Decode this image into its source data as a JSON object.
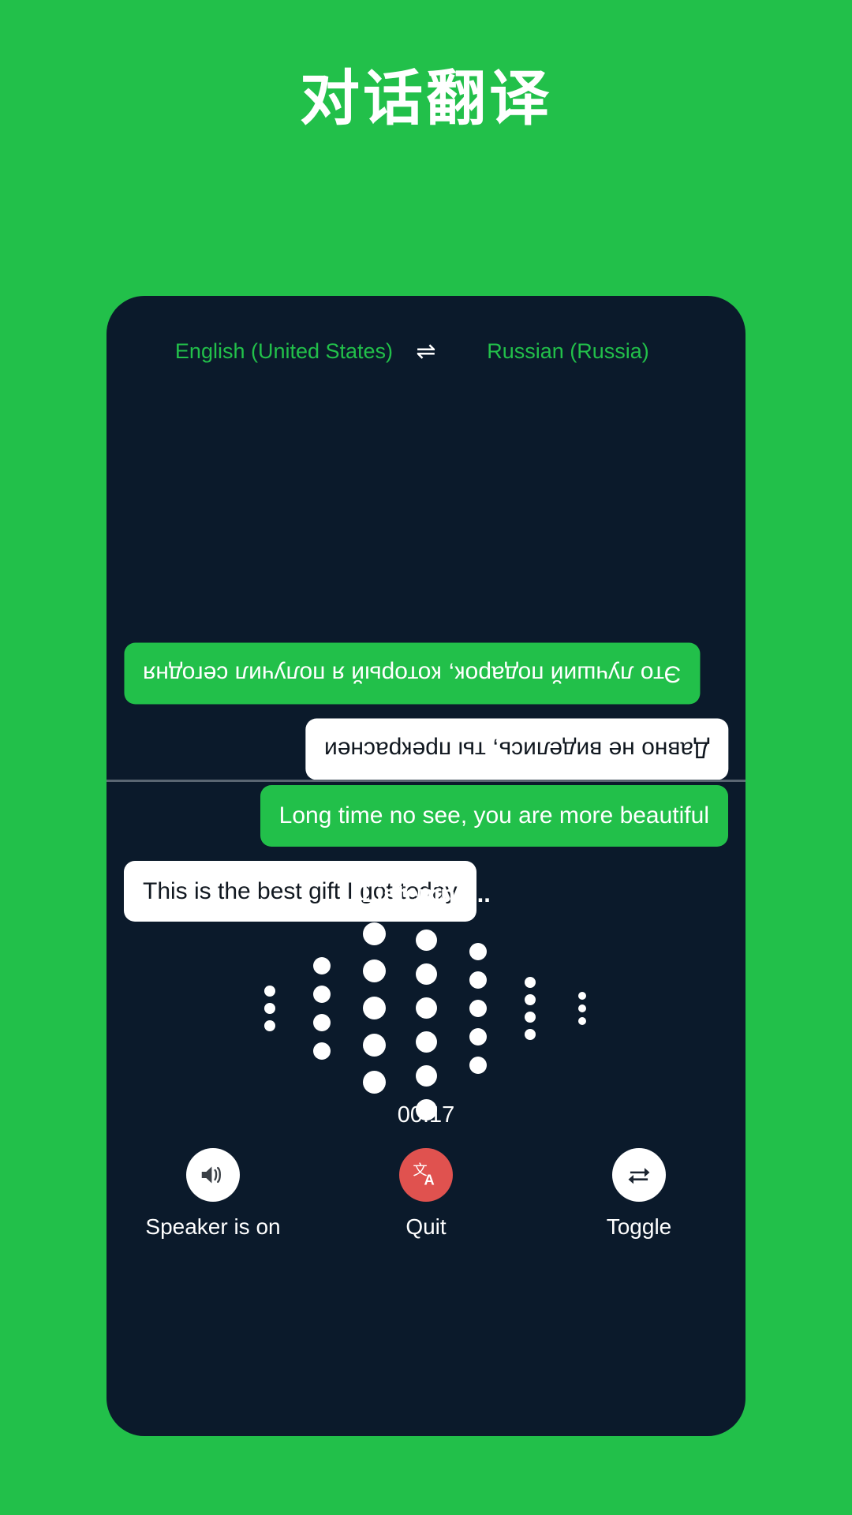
{
  "page": {
    "title": "对话翻译",
    "background_color": "#22c04a",
    "card_color": "#0b1a2b"
  },
  "header": {
    "source_language": "English (United States)",
    "target_language": "Russian (Russia)",
    "swap_icon": "swap-horizontal-arrows-icon",
    "swap_glyph": "⇌",
    "language_color": "#22c04a"
  },
  "conversation": {
    "remote_pane": {
      "orientation": "rotated-180",
      "messages": [
        {
          "id": "remote-msg-1",
          "text": "Это лучший подарок, который я получил сегодня",
          "style": "green",
          "align": "left"
        },
        {
          "id": "remote-msg-2",
          "text": "Давно не виделись, ты прекраснеи",
          "style": "white",
          "align": "right"
        }
      ]
    },
    "local_pane": {
      "orientation": "normal",
      "messages": [
        {
          "id": "local-msg-1",
          "text": "Long time no see, you are more beautiful",
          "style": "green",
          "align": "right"
        },
        {
          "id": "local-msg-2",
          "text": "This is the best gift I got today",
          "style": "white",
          "align": "left"
        }
      ]
    }
  },
  "status": {
    "listening_label": "Listening...",
    "timer": "00:17"
  },
  "waveform": {
    "type": "dot-bars",
    "columns": [
      {
        "dots": 3,
        "size": 14
      },
      {
        "dots": 4,
        "size": 22
      },
      {
        "dots": 5,
        "size": 29
      },
      {
        "dots": 7,
        "size": 27
      },
      {
        "dots": 5,
        "size": 22
      },
      {
        "dots": 4,
        "size": 14
      },
      {
        "dots": 3,
        "size": 10
      }
    ],
    "dot_color": "#ffffff"
  },
  "controls": [
    {
      "id": "speaker",
      "label": "Speaker is on",
      "icon": "speaker-volume-icon",
      "circle_color": "#ffffff",
      "icon_color": "#3a3f45"
    },
    {
      "id": "quit",
      "label": "Quit",
      "icon": "translate-icon",
      "circle_color": "#e0524f",
      "icon_color": "#ffffff"
    },
    {
      "id": "toggle",
      "label": "Toggle",
      "icon": "swap-repeat-arrows-icon",
      "circle_color": "#ffffff",
      "icon_color": "#1b2430"
    }
  ]
}
